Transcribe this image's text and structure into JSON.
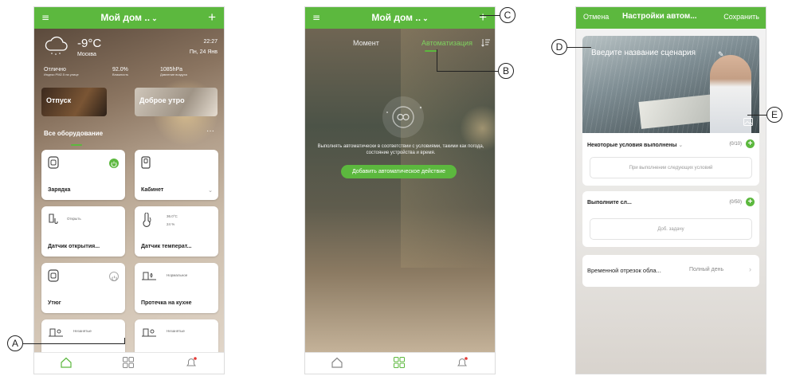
{
  "phone1": {
    "title": "Мой дом ..",
    "title_chevron": "⌄",
    "menu_icon": "≡",
    "add_icon": "+",
    "weather": {
      "temp": "-9°C",
      "city": "Москва",
      "time": "22:27",
      "date": "Пн, 24 Янв",
      "stats": [
        {
          "value": "Отлично",
          "label": "Индекс PM2.5 на улице"
        },
        {
          "value": "92.0%",
          "label": "Влажность"
        },
        {
          "value": "1085hPa",
          "label": "Давление воздуха"
        }
      ]
    },
    "scenes": [
      "Отпуск",
      "Доброе утро"
    ],
    "section_title": "Все оборудование",
    "section_more": "···",
    "cards": [
      {
        "name": "Зарядка",
        "status": ""
      },
      {
        "name": "Кабинет",
        "status": ""
      },
      {
        "name": "Датчик открытия...",
        "status": "Открыть"
      },
      {
        "name": "Датчик температ...",
        "status_temp": "36.0°C",
        "status_hum": "24 %"
      },
      {
        "name": "Утюг",
        "status": ""
      },
      {
        "name": "Протечка на кухне",
        "status": "Нормальное"
      },
      {
        "name": "",
        "status": "Незанятые"
      },
      {
        "name": "",
        "status": "Незанятые"
      }
    ]
  },
  "phone2": {
    "title": "Мой дом ..",
    "title_chevron": "⌄",
    "menu_icon": "≡",
    "add_icon": "+",
    "tabs": [
      "Момент",
      "Автоматизация"
    ],
    "description": "Выполнять автоматически в соответствии с условиями, такими как погода, состояние устройства и время.",
    "button": "Добавить автоматическое действие"
  },
  "phone3": {
    "cancel": "Отмена",
    "title": "Настройки автом...",
    "save": "Сохранить",
    "scenario_placeholder": "Введите название сценария",
    "edit_icon": "✎",
    "conditions": {
      "title": "Некоторые условия выполнены",
      "count": "(0/10)",
      "box": "При выполнении следующих условий"
    },
    "actions": {
      "title": "Выполните сл...",
      "count": "(0/50)",
      "box": "Доб. задачу"
    },
    "time_period": {
      "label": "Временной отрезок обла...",
      "value": "Полный день"
    }
  },
  "callouts": [
    "A",
    "B",
    "C",
    "D",
    "E"
  ],
  "colors": {
    "accent": "#5cb83e",
    "notify": "#e53935"
  }
}
